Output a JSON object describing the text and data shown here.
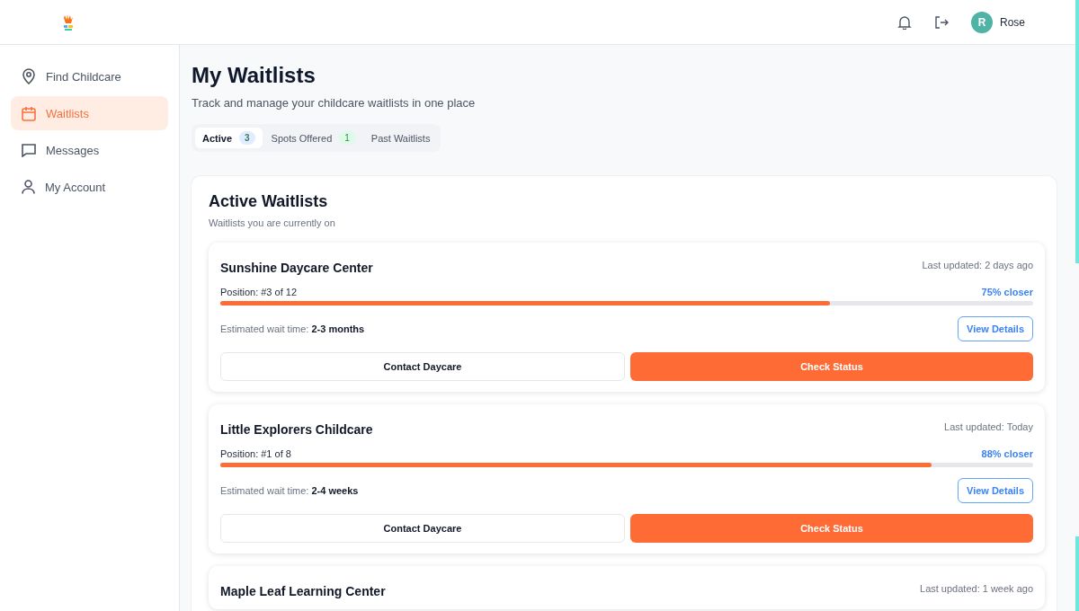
{
  "header": {
    "user": {
      "initial": "R",
      "name": "Rose"
    }
  },
  "sidebar": {
    "items": [
      {
        "label": "Find Childcare",
        "kind": "pin",
        "selected": false
      },
      {
        "label": "Waitlists",
        "kind": "calendar",
        "selected": true
      },
      {
        "label": "Messages",
        "kind": "chat",
        "selected": false
      },
      {
        "label": "My Account",
        "kind": "person",
        "selected": false
      }
    ]
  },
  "page": {
    "title": "My Waitlists",
    "subtitle": "Track and manage your childcare waitlists in one place"
  },
  "tabs": [
    {
      "label": "Active",
      "count": "3",
      "color": "#e0ecff",
      "selected": true
    },
    {
      "label": "Spots Offered",
      "count": "1",
      "color": "#dcfce7",
      "selected": false
    },
    {
      "label": "Past Waitlists",
      "selected": false
    }
  ],
  "section": {
    "title": "Active Waitlists",
    "subtitle": "Waitlists you are currently on",
    "waitlists": [
      {
        "name": "Sunshine Daycare Center",
        "updated": "Last updated: 2 days ago",
        "position": "Position: #3 of 12",
        "progress_label": "75% closer",
        "level": 0.75,
        "wait_label": "Estimated wait time:",
        "wait_value": "2-3 months",
        "details_button": "View Details",
        "contact_button": "Contact Daycare",
        "status_button": "Check Status"
      },
      {
        "name": "Little Explorers Childcare",
        "updated": "Last updated: Today",
        "position": "Position: #1 of 8",
        "progress_label": "88% closer",
        "level": 0.875,
        "wait_label": "Estimated wait time:",
        "wait_value": "2-4 weeks",
        "details_button": "View Details",
        "contact_button": "Contact Daycare",
        "status_button": "Check Status"
      },
      {
        "name": "Maple Leaf Learning Center",
        "updated": "Last updated: 1 week ago"
      }
    ]
  }
}
